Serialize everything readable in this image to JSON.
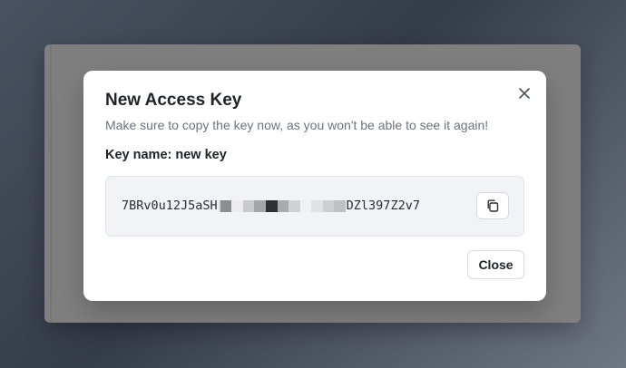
{
  "dialog": {
    "title": "New Access Key",
    "subtitle": "Make sure to copy the key now, as you won't be able to see it again!",
    "key_name_label": "Key name: new key",
    "key_prefix": "7BRv0u12J5aSH",
    "key_suffix": "DZl397Z2v7",
    "close_button_label": "Close",
    "close_icon": "close-icon",
    "copy_icon": "copy-icon"
  },
  "colors": {
    "backdrop": "#7f7f7f",
    "modal_bg": "#ffffff",
    "key_box_bg": "#f2f3f7"
  }
}
